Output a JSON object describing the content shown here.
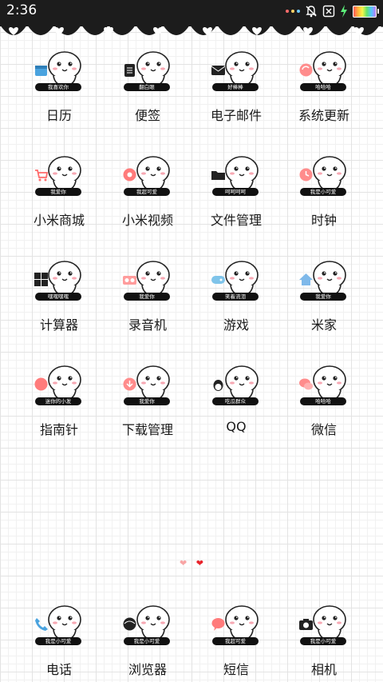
{
  "status_bar": {
    "time": "2:36",
    "battery_colors": [
      "#ff5a5a",
      "#ffb13b",
      "#f7f74a",
      "#63e36b",
      "#53c7ff",
      "#c07cff"
    ],
    "icons": [
      "notification-dots-icon",
      "bell-off-icon",
      "close-box-icon",
      "charging-bolt-icon",
      "battery-icon"
    ]
  },
  "apps": [
    {
      "label": "日历",
      "tag": "我喜欢你",
      "icon": "calendar-icon"
    },
    {
      "label": "便签",
      "tag": "翻白眼",
      "icon": "notes-icon"
    },
    {
      "label": "电子邮件",
      "tag": "好棒棒",
      "icon": "mail-icon"
    },
    {
      "label": "系统更新",
      "tag": "哈哈哈",
      "icon": "update-icon"
    },
    {
      "label": "小米商城",
      "tag": "我爱你",
      "icon": "cart-icon"
    },
    {
      "label": "小米视频",
      "tag": "我超可爱",
      "icon": "video-icon"
    },
    {
      "label": "文件管理",
      "tag": "呵呵呵呵",
      "icon": "folder-icon"
    },
    {
      "label": "时钟",
      "tag": "我是小可爱",
      "icon": "clock-icon"
    },
    {
      "label": "计算器",
      "tag": "嘿嘿嘿嘿",
      "icon": "calculator-icon"
    },
    {
      "label": "录音机",
      "tag": "我爱你",
      "icon": "recorder-icon"
    },
    {
      "label": "游戏",
      "tag": "笑着流泪",
      "icon": "gamepad-icon"
    },
    {
      "label": "米家",
      "tag": "我爱你",
      "icon": "home-icon"
    },
    {
      "label": "指南针",
      "tag": "迷你的小发",
      "icon": "compass-icon"
    },
    {
      "label": "下载管理",
      "tag": "我爱你",
      "icon": "download-icon"
    },
    {
      "label": "QQ",
      "tag": "吃瓜群众",
      "icon": "qq-penguin-icon"
    },
    {
      "label": "微信",
      "tag": "哈哈哈",
      "icon": "wechat-icon"
    }
  ],
  "dock": [
    {
      "label": "电话",
      "tag": "我是小可爱",
      "icon": "phone-icon"
    },
    {
      "label": "浏览器",
      "tag": "我是小可爱",
      "icon": "browser-icon"
    },
    {
      "label": "短信",
      "tag": "我超可爱",
      "icon": "message-icon"
    },
    {
      "label": "相机",
      "tag": "我是小可爱",
      "icon": "camera-icon"
    }
  ],
  "page_indicator": {
    "pages": 2,
    "current": 2,
    "colors": {
      "inactive": "#f8a5a5",
      "active": "#e8232a"
    }
  }
}
